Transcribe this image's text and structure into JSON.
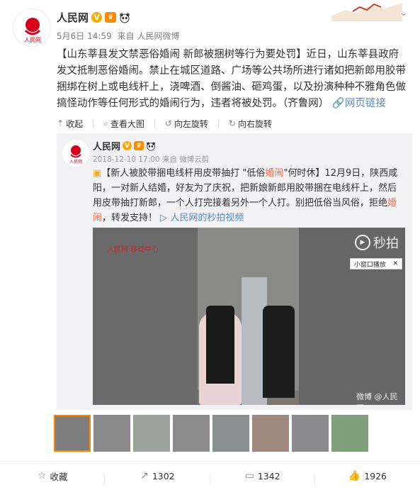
{
  "post": {
    "author": "人民网",
    "date": "5月6日 14:59",
    "source_prefix": "来自",
    "source": "人民网微博",
    "text_title": "【山东莘县发文禁恶俗婚闹 新郎被捆树等行为要处罚】",
    "text_body": "近日，山东莘县政府发文抵制恶俗婚闹。禁止在城区道路、广场等公共场所进行诸如把新郎用胶带捆绑在树上或电线杆上，浇啤酒、倒酱油、砸鸡蛋，以及扮演种种不雅角色做搞怪动作等任何形式的婚闹行为，违者将被处罚。（齐鲁网）",
    "link_label": "网页链接"
  },
  "toolbar": {
    "collapse": "收起",
    "view_large": "查看大图",
    "rotate_left": "向左旋转",
    "rotate_right": "向右旋转"
  },
  "repost": {
    "author": "人民网",
    "date": "2018-12-10 17:00",
    "source_prefix": "来自",
    "source": "微博云剪",
    "text_a": "【新人被胶带捆电线杆用皮带抽打 \"低俗",
    "text_hl1": "婚闹",
    "text_b": "\"何时休】12月9日，陕西咸阳，一对新人结婚，好友为了庆祝，把新娘新郎用胶带捆在电线杆上，然后用皮带抽打新郎，一个人打完接着另外一个人打。别把低俗当风俗，拒绝",
    "text_hl2": "婚闹",
    "text_c": "，转发支持！",
    "video_link": "人民网的秒拍视频"
  },
  "video": {
    "corner_logo": "人民网 移动中心",
    "brand": "秒拍",
    "pip_label": "小窗口播放",
    "watermark": "微博 @人民网"
  },
  "actions": {
    "favorite": "收藏",
    "repost_count": "1302",
    "comment_count": "1342",
    "like_count": "1926"
  },
  "colors": {
    "accent": "#eb7350",
    "link_blue": "#5b8cc9",
    "selected_thumb": "#ff8200"
  }
}
